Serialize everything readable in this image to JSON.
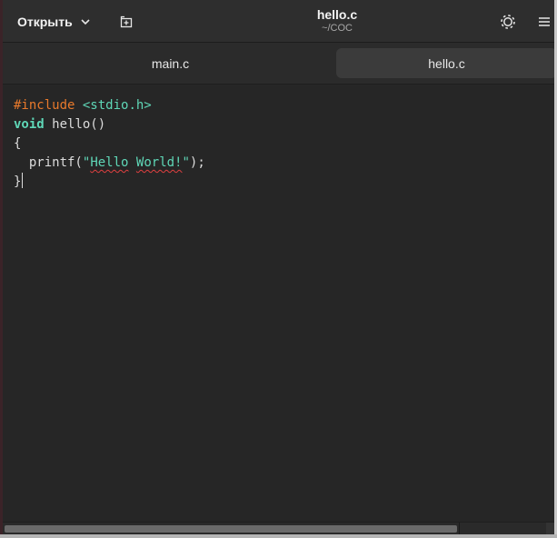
{
  "header": {
    "open_label": "Открыть",
    "title": "hello.c",
    "subtitle": "~/COC"
  },
  "icons": {
    "open_dropdown": "chevron-down-icon",
    "new_tab": "new-tab-icon",
    "settings": "gear-icon",
    "menu": "hamburger-menu-icon"
  },
  "tabs": [
    {
      "label": "main.c",
      "active": false
    },
    {
      "label": "hello.c",
      "active": true
    }
  ],
  "editor": {
    "line1": {
      "directive": "#include",
      "header": "<stdio.h>"
    },
    "line2": {
      "keyword": "void",
      "rest": "hello()"
    },
    "line3": {
      "text": "{"
    },
    "line4": {
      "indent": "  ",
      "fn": "printf(",
      "q1": "\"",
      "s1": "Hello",
      "sp": " ",
      "s2": "World!",
      "q2": "\"",
      "end": ");"
    },
    "line5": {
      "text": "}"
    }
  },
  "colors": {
    "background": "#262626",
    "preprocessor": "#e8792b",
    "keyword": "#5fd7b7",
    "string": "#5fd7b7",
    "spell_error": "#e04040"
  }
}
